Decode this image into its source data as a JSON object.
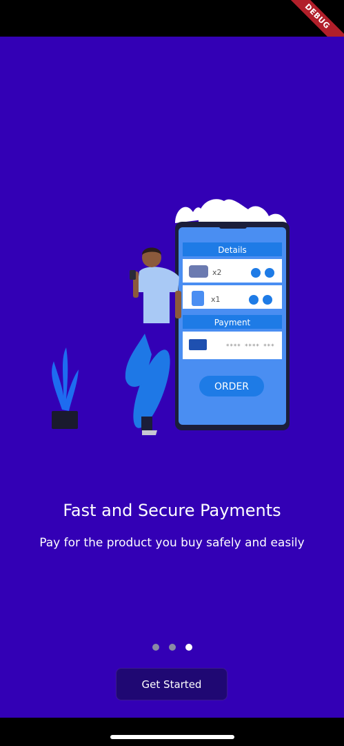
{
  "debug_banner": "DEBUG",
  "onboarding": {
    "title": "Fast and Secure Payments",
    "subtitle": "Pay for the product you buy safely and easily",
    "page_index": 3,
    "page_count": 3,
    "cta_label": "Get Started"
  },
  "illustration": {
    "details_header": "Details",
    "item1_qty": "x2",
    "item2_qty": "x1",
    "payment_header": "Payment",
    "card_mask": "**** **** ***",
    "order_button": "ORDER"
  },
  "colors": {
    "background": "#3300b5",
    "button": "#1f0873",
    "accent_blue": "#1e88e5",
    "dot_active": "#ffffff",
    "dot_inactive": "#8a8aa5"
  }
}
